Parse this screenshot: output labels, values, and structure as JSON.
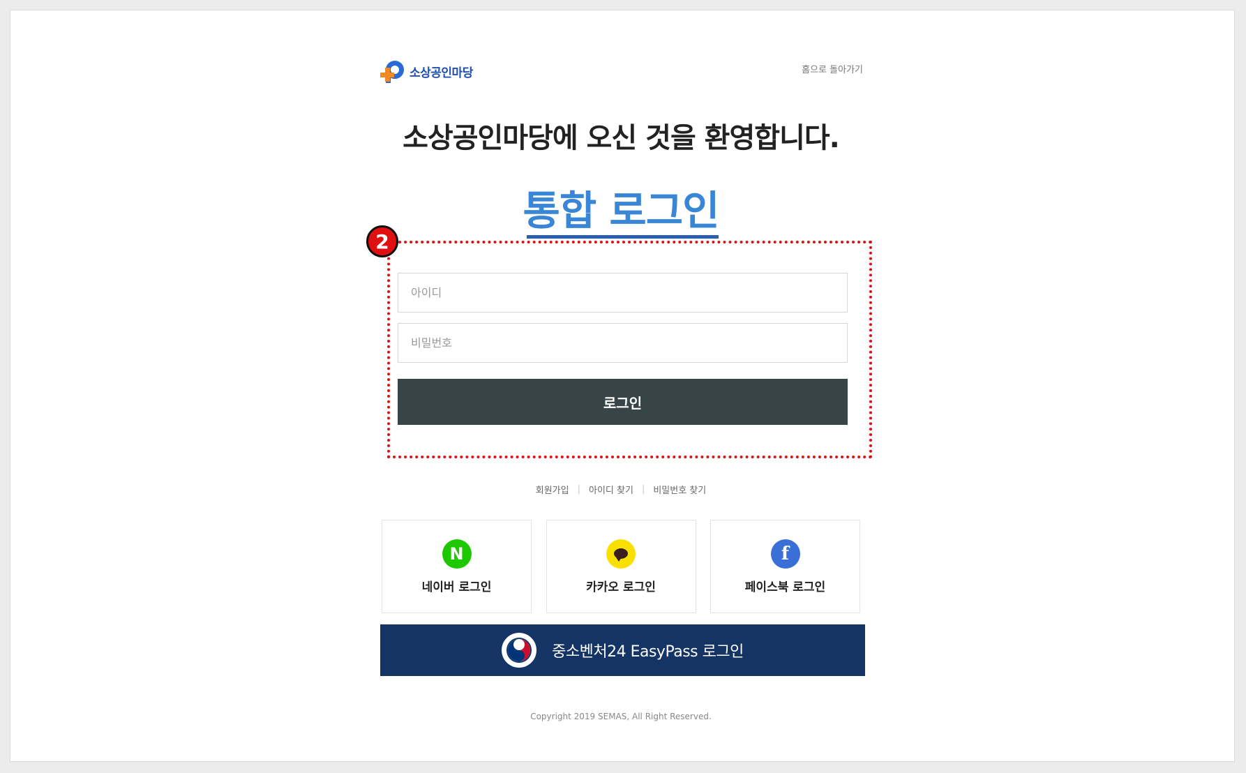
{
  "header": {
    "logo_text": "소상공인마당",
    "home_link": "홈으로 돌아가기"
  },
  "welcome": "소상공인마당에 오신 것을 환영합니다.",
  "login_title": "통합 로그인",
  "annotation_badge": "2",
  "form": {
    "id_placeholder": "아이디",
    "password_placeholder": "비밀번호",
    "login_button": "로그인"
  },
  "links": {
    "signup": "회원가입",
    "find_id": "아이디 찾기",
    "find_password": "비밀번호 찾기"
  },
  "social": {
    "naver": {
      "label": "네이버 로그인",
      "icon_letter": "N",
      "icon": "naver-icon",
      "color": "#1ec800"
    },
    "kakao": {
      "label": "카카오 로그인",
      "icon": "kakao-icon",
      "color": "#f9e000"
    },
    "facebook": {
      "label": "페이스북 로그인",
      "icon_letter": "f",
      "icon": "facebook-icon",
      "color": "#3b6fd8"
    }
  },
  "easypass": {
    "label": "중소벤처24 EasyPass 로그인",
    "color": "#133464"
  },
  "copyright": "Copyright 2019 SEMAS, All Right Reserved.",
  "colors": {
    "accent": "#3a86d6",
    "login_button": "#384548",
    "highlight": "#e01010"
  }
}
